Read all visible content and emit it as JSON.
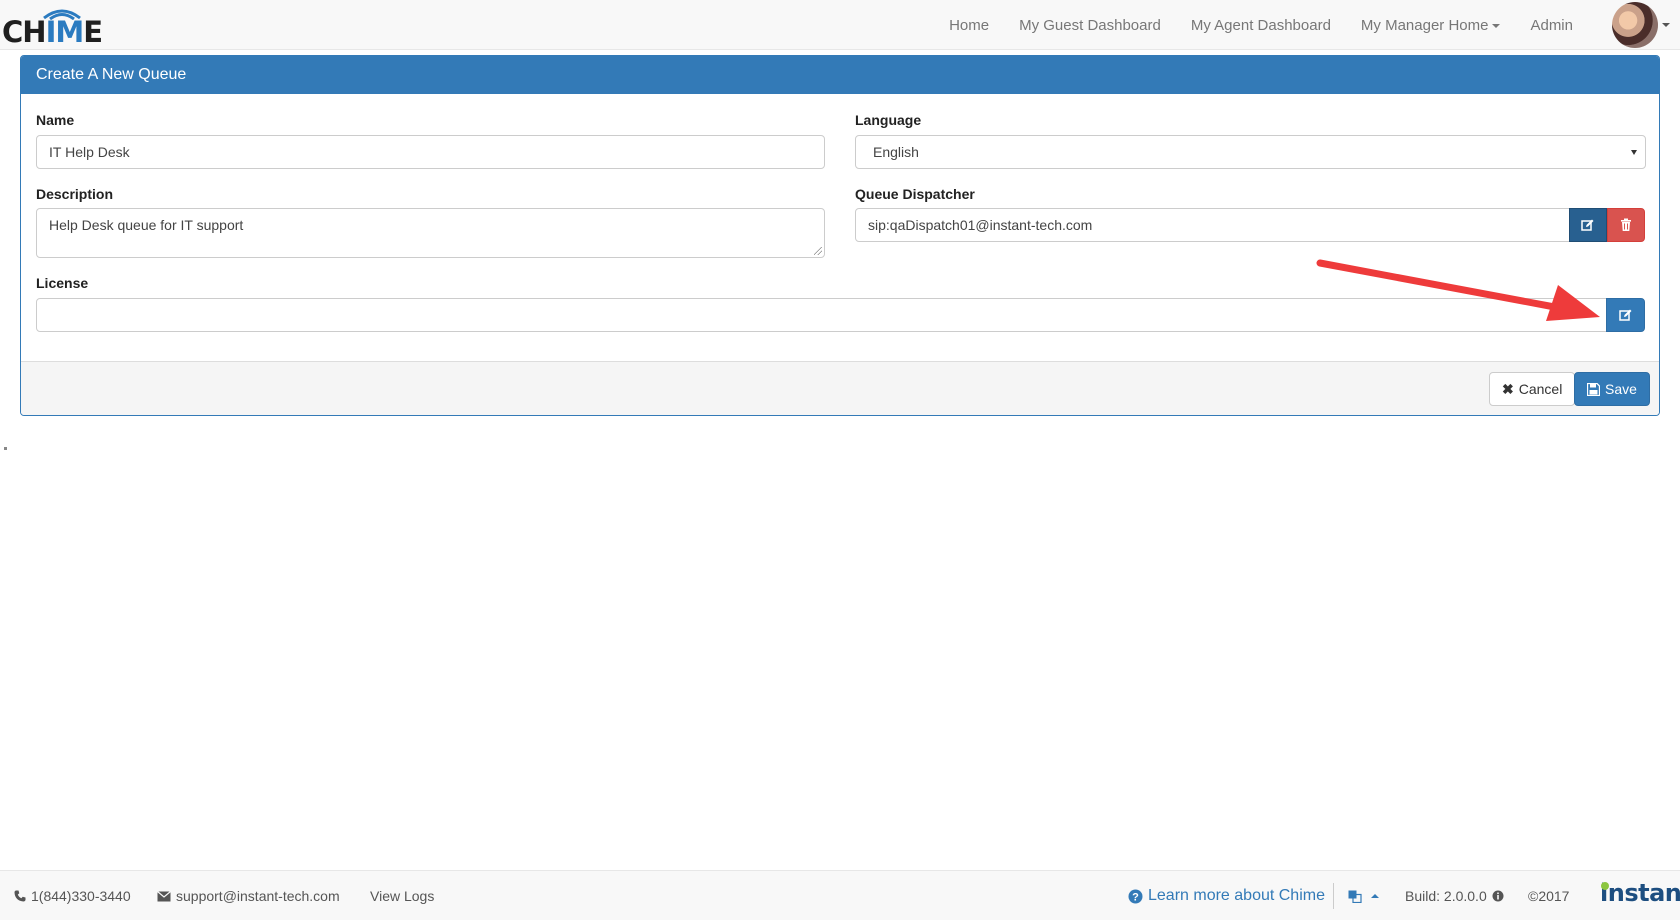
{
  "nav": {
    "logo_text_start": "CH",
    "logo_text_mid": "IM",
    "logo_text_end": "E",
    "links": [
      {
        "label": "Home"
      },
      {
        "label": "My Guest Dashboard"
      },
      {
        "label": "My Agent Dashboard"
      },
      {
        "label": "My Manager Home"
      },
      {
        "label": "Admin"
      }
    ]
  },
  "panel": {
    "title": "Create A New Queue",
    "name": {
      "label": "Name",
      "value": "IT Help Desk"
    },
    "description": {
      "label": "Description",
      "value": "Help Desk queue for IT support"
    },
    "language": {
      "label": "Language",
      "value": "English"
    },
    "dispatcher": {
      "label": "Queue Dispatcher",
      "value": "sip:qaDispatch01@instant-tech.com"
    },
    "license": {
      "label": "License",
      "value": ""
    },
    "cancel_label": "Cancel",
    "save_label": "Save"
  },
  "footer": {
    "phone": "1(844)330-3440",
    "email": "support@instant-tech.com",
    "view_logs": "View Logs",
    "learn_more": "Learn more about Chime",
    "build": "Build: 2.0.0.0",
    "copyright": "©2017",
    "brand": "instant"
  },
  "colors": {
    "primary": "#337ab7",
    "danger": "#d9534f",
    "annotation_arrow": "#ee3b3b"
  },
  "icons": [
    "edit-icon",
    "trash-icon",
    "times-icon",
    "save-icon",
    "phone-icon",
    "envelope-icon",
    "question-circle-icon",
    "language-icon",
    "info-circle-icon"
  ]
}
